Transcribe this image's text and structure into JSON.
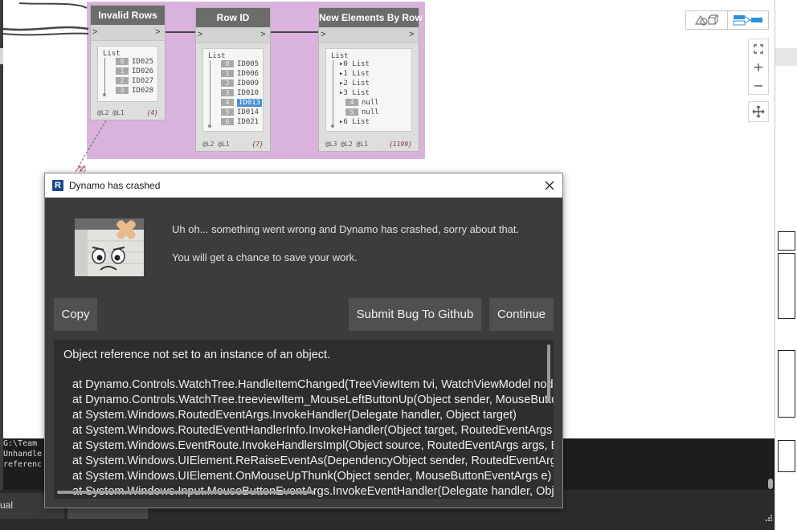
{
  "nodes": [
    {
      "id": "invalid-rows",
      "title": "Invalid Rows",
      "list_label": "List",
      "rows": [
        {
          "idx": "0",
          "val": "ID025"
        },
        {
          "idx": "1",
          "val": "ID026"
        },
        {
          "idx": "2",
          "val": "ID027"
        },
        {
          "idx": "3",
          "val": "ID028"
        }
      ],
      "levels": "@L2 @L1",
      "count": "{4}"
    },
    {
      "id": "row-id",
      "title": "Row ID",
      "list_label": "List",
      "rows": [
        {
          "idx": "0",
          "val": "ID005"
        },
        {
          "idx": "1",
          "val": "ID006"
        },
        {
          "idx": "2",
          "val": "ID009"
        },
        {
          "idx": "3",
          "val": "ID010"
        },
        {
          "idx": "4",
          "val": "ID013",
          "selected": true
        },
        {
          "idx": "5",
          "val": "ID014"
        },
        {
          "idx": "6",
          "val": "ID021"
        }
      ],
      "levels": "@L2 @L1",
      "count": "{7}"
    },
    {
      "id": "new-elements-by-row",
      "title": "New Elements By Row",
      "list_label": "List",
      "rows": [
        {
          "idx": "0",
          "val": "List",
          "expander": true
        },
        {
          "idx": "1",
          "val": "List",
          "expander": true
        },
        {
          "idx": "2",
          "val": "List",
          "expander": true
        },
        {
          "idx": "3",
          "val": "List",
          "expander": true
        },
        {
          "idx": "4",
          "val": "null"
        },
        {
          "idx": "5",
          "val": "null"
        },
        {
          "idx": "6",
          "val": "List",
          "expander": true
        }
      ],
      "levels": "@L3 @L2 @L1",
      "count": "{1199}"
    }
  ],
  "console": {
    "lines": [
      "G:\\Team",
      "Unhandle",
      "referenc"
    ]
  },
  "bottom": {
    "tab_label": "ual"
  },
  "dialog": {
    "title": "Dynamo has crashed",
    "app_icon_letter": "R",
    "message_primary": "Uh oh... something went wrong and Dynamo has crashed, sorry about that.",
    "message_secondary": "You will get a chance to save your work.",
    "buttons": {
      "copy": "Copy",
      "submit": "Submit Bug To Github",
      "continue": "Continue"
    },
    "details": {
      "first_line": "Object reference not set to an instance of an object.",
      "stack": [
        "at Dynamo.Controls.WatchTree.HandleItemChanged(TreeViewItem tvi, WatchViewModel node)",
        "at Dynamo.Controls.WatchTree.treeviewItem_MouseLeftButtonUp(Object sender, MouseButtonEventArgs e)",
        "at System.Windows.RoutedEventArgs.InvokeHandler(Delegate handler, Object target)",
        "at System.Windows.RoutedEventHandlerInfo.InvokeHandler(Object target, RoutedEventArgs routedEventArgs)",
        "at System.Windows.EventRoute.InvokeHandlersImpl(Object source, RoutedEventArgs args, Boolean reRaised)",
        "at System.Windows.UIElement.ReRaiseEventAs(DependencyObject sender, RoutedEventArgs args, RoutedEvent newEvent)",
        "at System.Windows.UIElement.OnMouseUpThunk(Object sender, MouseButtonEventArgs e)",
        "at System.Windows.Input.MouseButtonEventArgs.InvokeEventHandler(Delegate handler, Object target)"
      ]
    }
  },
  "icons": {
    "close": "close-icon",
    "geometry_view": "geometry-view-icon",
    "graph_view": "graph-view-icon",
    "zoom_fit": "zoom-fit-icon",
    "zoom_in": "zoom-in-icon",
    "zoom_out": "zoom-out-icon",
    "pan": "pan-icon",
    "mascot": "crashed-mascot-icon"
  },
  "colors": {
    "group_background": "#d9b3de",
    "dialog_background": "#3c3c3c",
    "button_background": "#505050",
    "selected_row": "#4a8fd4",
    "graph_view_accent": "#2f8fd8"
  }
}
